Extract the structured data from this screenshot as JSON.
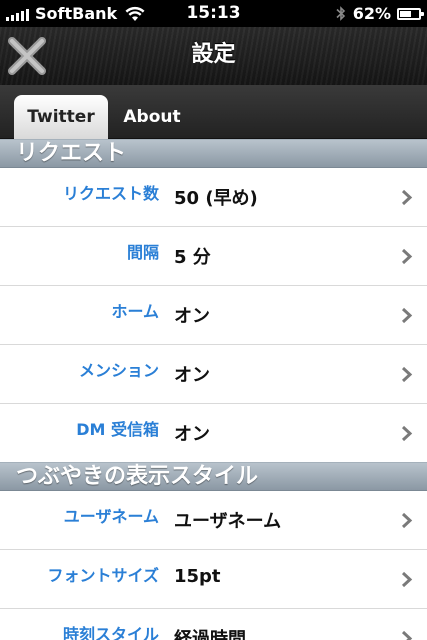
{
  "status_bar": {
    "carrier": "SoftBank",
    "time": "15:13",
    "battery_percent": "62%",
    "battery_level": 0.62
  },
  "nav_bar": {
    "title": "設定",
    "close_icon": "close-x-icon"
  },
  "tabs": [
    {
      "label": "Twitter",
      "active": true
    },
    {
      "label": "About",
      "active": false
    }
  ],
  "sections": [
    {
      "header": "リクエスト",
      "rows": [
        {
          "label": "リクエスト数",
          "value": "50 (早め)"
        },
        {
          "label": "間隔",
          "value": "5 分"
        },
        {
          "label": "ホーム",
          "value": "オン"
        },
        {
          "label": "メンション",
          "value": "オン"
        },
        {
          "label": "DM 受信箱",
          "value": "オン"
        }
      ]
    },
    {
      "header": "つぶやきの表示スタイル",
      "rows": [
        {
          "label": "ユーザネーム",
          "value": "ユーザネーム"
        },
        {
          "label": "フォントサイズ",
          "value": "15pt"
        },
        {
          "label": "時刻スタイル",
          "value": "経過時間"
        }
      ]
    }
  ],
  "colors": {
    "label_blue": "#2a7fd6",
    "section_header": "#9aa6b1"
  }
}
